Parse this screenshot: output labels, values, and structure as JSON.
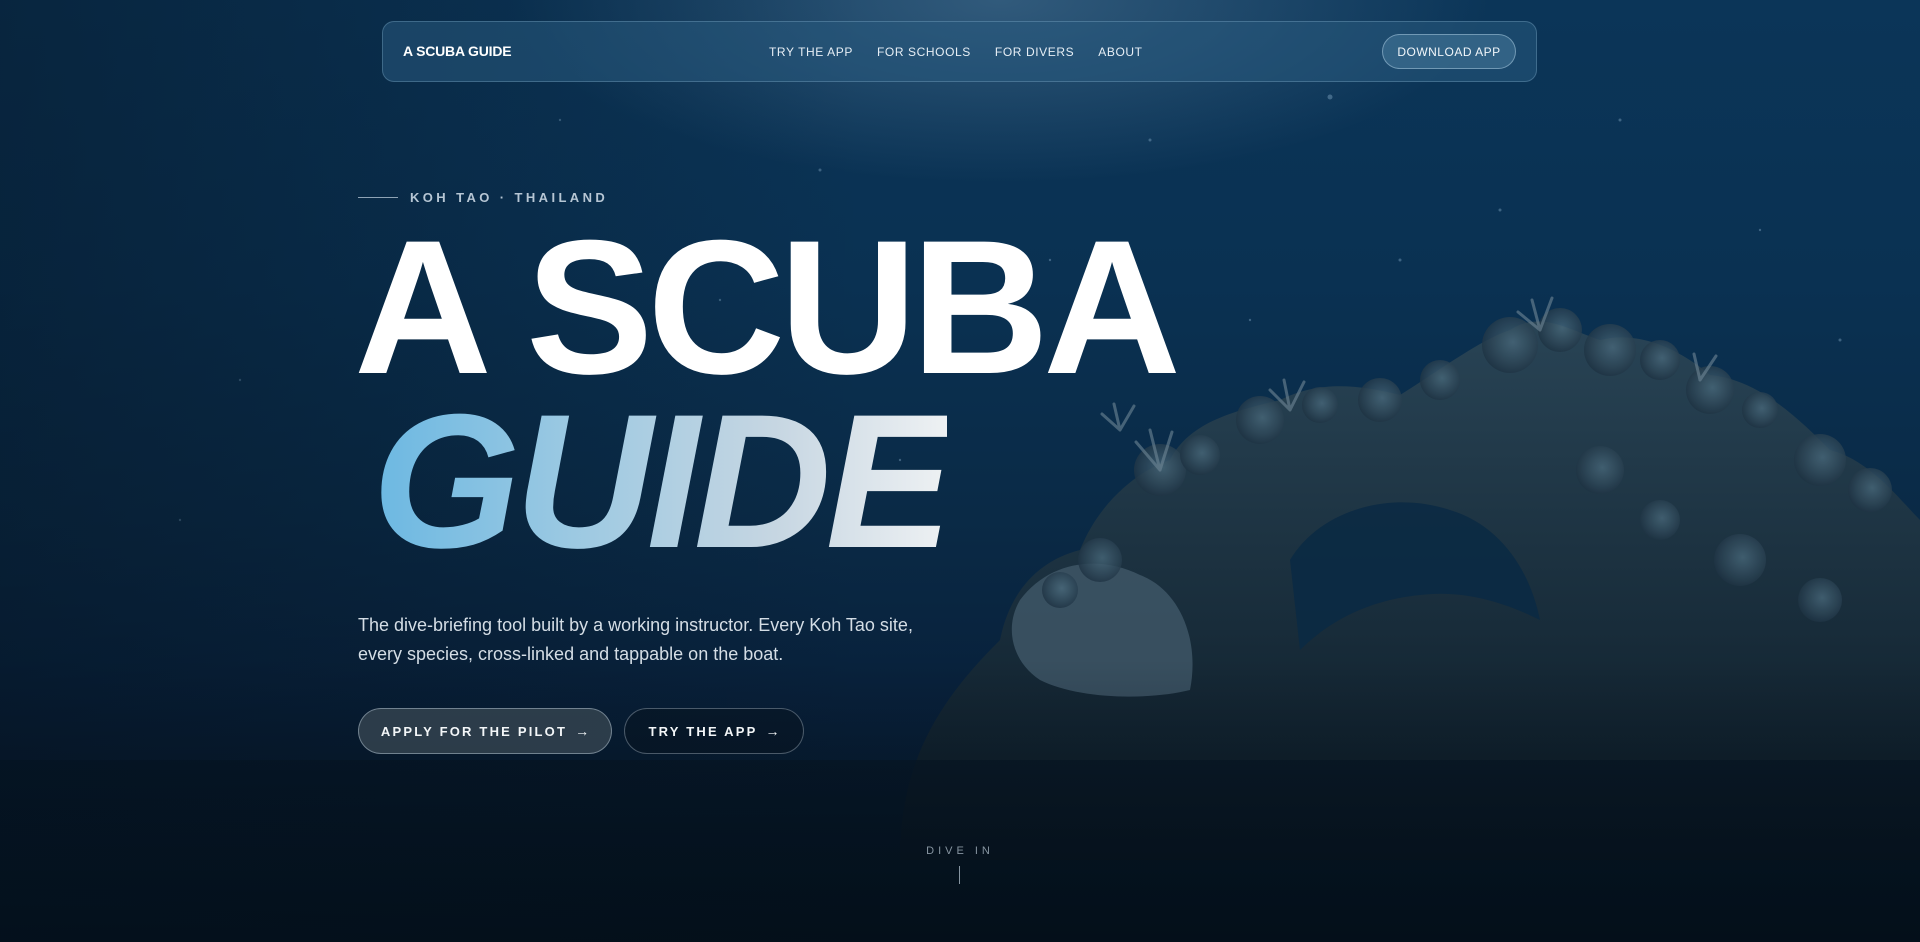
{
  "nav": {
    "brand": "A SCUBA GUIDE",
    "links": [
      {
        "label": "TRY THE APP"
      },
      {
        "label": "FOR SCHOOLS"
      },
      {
        "label": "FOR DIVERS"
      },
      {
        "label": "ABOUT"
      }
    ],
    "download_label": "DOWNLOAD APP"
  },
  "hero": {
    "eyebrow": "KOH TAO · THAILAND",
    "headline_line1": "A SCUBA",
    "headline_line2": "GUIDE",
    "lede": "The dive-briefing tool built by a working instructor. Every Koh Tao site, every species, cross-linked and tappable on the boat.",
    "cta_primary": "APPLY FOR THE PILOT",
    "cta_secondary": "TRY THE APP",
    "arrow": "→",
    "scroll_hint": "DIVE IN"
  },
  "colors": {
    "background_top": "#0b3558",
    "background_bottom": "#061624",
    "accent_gradient_start": "#6bb8e2",
    "accent_gradient_end": "#eef1f3"
  }
}
